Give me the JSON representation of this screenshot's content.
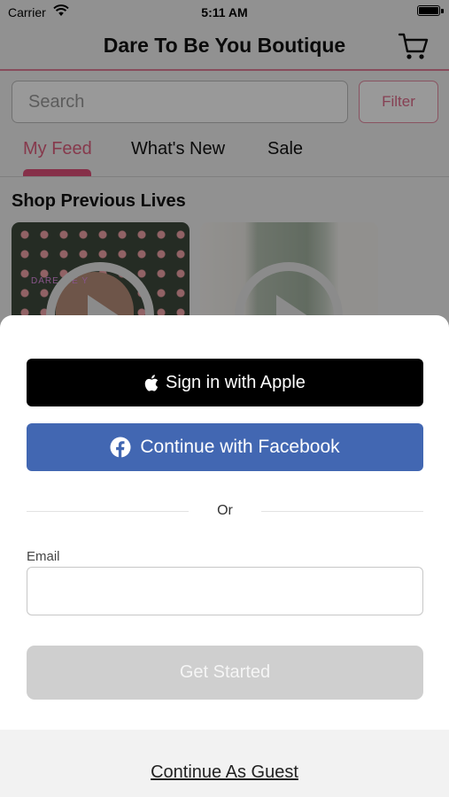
{
  "status_bar": {
    "carrier": "Carrier",
    "time": "5:11 AM"
  },
  "header": {
    "title": "Dare To Be You Boutique"
  },
  "search": {
    "placeholder": "Search",
    "filter_label": "Filter"
  },
  "tabs": [
    {
      "label": "My Feed",
      "active": true
    },
    {
      "label": "What's New",
      "active": false
    },
    {
      "label": "Sale",
      "active": false
    }
  ],
  "section": {
    "title": "Shop Previous Lives"
  },
  "thumbnails": [
    {
      "overlay_text": "DARE T   E Y"
    },
    {
      "overlay_text": ""
    }
  ],
  "sheet": {
    "apple_label": "Sign in with Apple",
    "facebook_label": "Continue with Facebook",
    "or_text": "Or",
    "email_label": "Email",
    "email_value": "",
    "get_started_label": "Get Started",
    "guest_label": "Continue As Guest"
  },
  "colors": {
    "brand_pink": "#e0607f",
    "facebook_blue": "#4267b2",
    "apple_black": "#000000",
    "disabled_gray": "#cfcfcf"
  },
  "icons": [
    "wifi-icon",
    "battery-icon",
    "cart-icon",
    "play-icon",
    "apple-logo-icon",
    "facebook-logo-icon"
  ]
}
